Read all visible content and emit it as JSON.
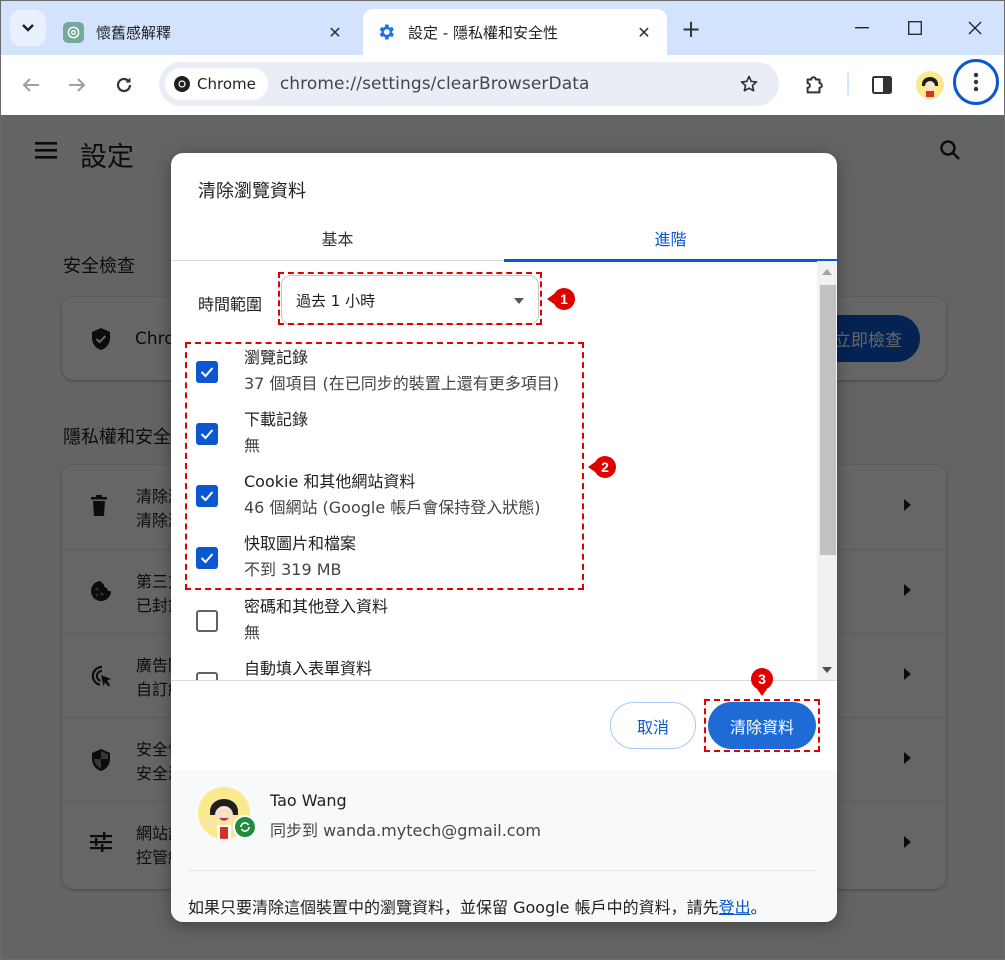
{
  "browser": {
    "tabs": [
      {
        "title": "懷舊感解釋",
        "favicon": "chatgpt-icon",
        "active": false
      },
      {
        "title": "設定 - 隱私權和安全性",
        "favicon": "gear-icon",
        "active": true
      }
    ],
    "omnibox": {
      "chip_label": "Chrome",
      "url": "chrome://settings/clearBrowserData"
    }
  },
  "settings_page": {
    "title": "設定",
    "safety_check": {
      "section_label": "安全檢查",
      "card_text": "Chrome",
      "button_label": "立即檢查"
    },
    "privacy": {
      "section_label": "隱私權和安全性",
      "rows": [
        {
          "title": "清除瀏覽資料",
          "subtitle": "清除瀏覽記錄、Cookie、快取等資料",
          "icon": "trash-icon"
        },
        {
          "title": "第三方 Cookie",
          "subtitle": "已封鎖第三方 Cookie",
          "icon": "cookie-icon"
        },
        {
          "title": "廣告隱私權",
          "subtitle": "自訂網站用來顯示廣告的資訊",
          "icon": "ad-privacy-icon"
        },
        {
          "title": "安全性",
          "subtitle": "安全瀏覽",
          "icon": "security-shield-icon"
        },
        {
          "title": "網站設定",
          "subtitle": "控管網站可以使用及顯示的資訊",
          "icon": "tune-icon"
        }
      ]
    }
  },
  "dialog": {
    "title": "清除瀏覽資料",
    "tabs": [
      {
        "label": "基本",
        "selected": false
      },
      {
        "label": "進階",
        "selected": true
      }
    ],
    "time_range": {
      "label": "時間範圍",
      "value": "過去 1 小時"
    },
    "items": [
      {
        "title": "瀏覽記錄",
        "subtitle": "37 個項目 (在已同步的裝置上還有更多項目)",
        "checked": true
      },
      {
        "title": "下載記錄",
        "subtitle": "無",
        "checked": true
      },
      {
        "title": "Cookie 和其他網站資料",
        "subtitle": "46 個網站 (Google 帳戶會保持登入狀態)",
        "checked": true
      },
      {
        "title": "快取圖片和檔案",
        "subtitle": "不到 319 MB",
        "checked": true
      },
      {
        "title": "密碼和其他登入資料",
        "subtitle": "無",
        "checked": false
      },
      {
        "title": "自動填入表單資料",
        "subtitle": "",
        "checked": false
      }
    ],
    "buttons": {
      "cancel": "取消",
      "clear": "清除資料"
    },
    "account": {
      "name": "Tao Wang",
      "sync_text": "同步到 wanda.mytech@gmail.com"
    },
    "footer_note": {
      "text": "如果只要清除這個裝置中的瀏覽資料，並保留 Google 帳戶中的資料，請先",
      "link": "登出",
      "suffix": "。"
    }
  },
  "annotations": {
    "markers": [
      "1",
      "2",
      "3"
    ],
    "color": "#e00000"
  },
  "colors": {
    "accent": "#0b57d0",
    "tabstrip": "#d3e3fd",
    "sync_badge": "#1e8e3e"
  }
}
